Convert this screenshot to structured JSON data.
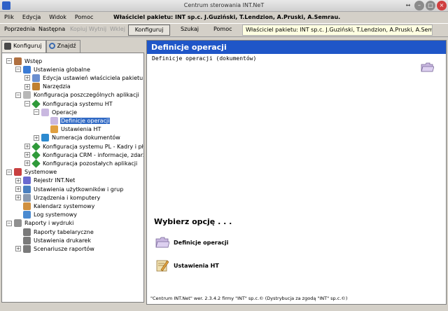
{
  "window": {
    "title": "Centrum sterowania INT.NeT"
  },
  "menu": [
    "Plik",
    "Edycja",
    "Widok",
    "Pomoc"
  ],
  "menubar_owner": "Właściciel pakietu: INT sp.c. J.Guziński, T.Lendzion, A.Pruski, A.Semrau.",
  "toolbar": {
    "buttons": [
      {
        "label": "Poprzednia",
        "enabled": true
      },
      {
        "label": "Następna",
        "enabled": true
      },
      {
        "label": "Kopiuj",
        "enabled": false
      },
      {
        "label": "Wytnij",
        "enabled": false
      },
      {
        "label": "Wklej",
        "enabled": false
      }
    ],
    "configure": "Konfiguruj",
    "search": "Szukaj",
    "help": "Pomoc",
    "owner": "Właściciel pakietu: INT sp.c. J.Guziński, T.Lendzion, A.Pruski, A.Semrau."
  },
  "tabs": [
    {
      "label": "Konfiguruj",
      "active": true
    },
    {
      "label": "Znajdź",
      "active": false
    }
  ],
  "tree": [
    {
      "label": "Wstęp",
      "level": 0,
      "exp": "-",
      "icon": "gears-icon",
      "color": "#b07040"
    },
    {
      "label": "Ustawienia globalne",
      "level": 1,
      "exp": "-",
      "icon": "globe-icon",
      "color": "#3a7bd5"
    },
    {
      "label": "Edycja ustawień właściciela pakietu",
      "level": 2,
      "exp": "+",
      "icon": "user-settings-icon",
      "color": "#6a8fd0"
    },
    {
      "label": "Narzędzia",
      "level": 2,
      "exp": "+",
      "icon": "tools-icon",
      "color": "#c08030"
    },
    {
      "label": "Konfiguracja poszczególnych aplikacji",
      "level": 1,
      "exp": "-",
      "icon": "apps-config-icon",
      "color": "#b8b8b8"
    },
    {
      "label": "Konfiguracja systemu HT",
      "level": 2,
      "exp": "-",
      "icon": "diamond-icon",
      "color": "#2f9a3a"
    },
    {
      "label": "Operacje",
      "level": 3,
      "exp": "-",
      "icon": "folder-open-icon",
      "color": "#c9b8e0"
    },
    {
      "label": "Definicje operacji",
      "level": 4,
      "exp": "",
      "icon": "folder-icon",
      "color": "#c9b8e0",
      "selected": true
    },
    {
      "label": "Ustawienia HT",
      "level": 4,
      "exp": "",
      "icon": "settings-pen-icon",
      "color": "#e0a040"
    },
    {
      "label": "Numeracja dokumentów",
      "level": 3,
      "exp": "+",
      "icon": "numbering-icon",
      "color": "#2c8ad0"
    },
    {
      "label": "Konfiguracja systemu PL - Kadry i płace",
      "level": 2,
      "exp": "+",
      "icon": "diamond-icon",
      "color": "#2f9a3a"
    },
    {
      "label": "Konfiguracja CRM - informacje, zdarzenia",
      "level": 2,
      "exp": "+",
      "icon": "diamond-icon",
      "color": "#2f9a3a"
    },
    {
      "label": "Konfiguracja pozostałych aplikacji",
      "level": 2,
      "exp": "+",
      "icon": "diamond-icon",
      "color": "#2f9a3a"
    },
    {
      "label": "Systemowe",
      "level": 0,
      "exp": "-",
      "icon": "system-icon",
      "color": "#c84040"
    },
    {
      "label": "Rejestr INT.Net",
      "level": 1,
      "exp": "+",
      "icon": "registry-icon",
      "color": "#6a6ad0"
    },
    {
      "label": "Ustawienia użytkowników i grup",
      "level": 1,
      "exp": "+",
      "icon": "users-icon",
      "color": "#4a80c0"
    },
    {
      "label": "Urządzenia i komputery",
      "level": 1,
      "exp": "+",
      "icon": "computer-icon",
      "color": "#8a9ab0"
    },
    {
      "label": "Kalendarz systemowy",
      "level": 1,
      "exp": "",
      "icon": "calendar-icon",
      "color": "#d09040"
    },
    {
      "label": "Log systemowy",
      "level": 1,
      "exp": "",
      "icon": "log-icon",
      "color": "#4a8ad0"
    },
    {
      "label": "Raporty i wydruki",
      "level": 0,
      "exp": "-",
      "icon": "reports-icon",
      "color": "#909090"
    },
    {
      "label": "Raporty tabelaryczne",
      "level": 1,
      "exp": "",
      "icon": "table-report-icon",
      "color": "#7a7a7a"
    },
    {
      "label": "Ustawienia drukarek",
      "level": 1,
      "exp": "",
      "icon": "printer-icon",
      "color": "#7a7a7a"
    },
    {
      "label": "Scenariusze raportów",
      "level": 1,
      "exp": "+",
      "icon": "scenario-icon",
      "color": "#7a7a7a"
    }
  ],
  "right": {
    "header": "Definicje operacji",
    "subtitle": "Definicje operacji (dokumentów)",
    "choose": "Wybierz opcję . . .",
    "options": [
      {
        "label": "Definicje operacji",
        "icon": "folder-icon",
        "color": "#c9b8e0"
      },
      {
        "label": "Ustawienia HT",
        "icon": "settings-pen-icon",
        "color": "#e0a040"
      }
    ],
    "footer": "\"Centrum INT.Net\" wer. 2.3.4.2 firmy \"INT\" sp.c.© (Dystrybucja za zgodą \"INT\" sp.c.©)"
  },
  "colors": {
    "header_blue": "#1f56c8",
    "selection": "#316ac5"
  }
}
